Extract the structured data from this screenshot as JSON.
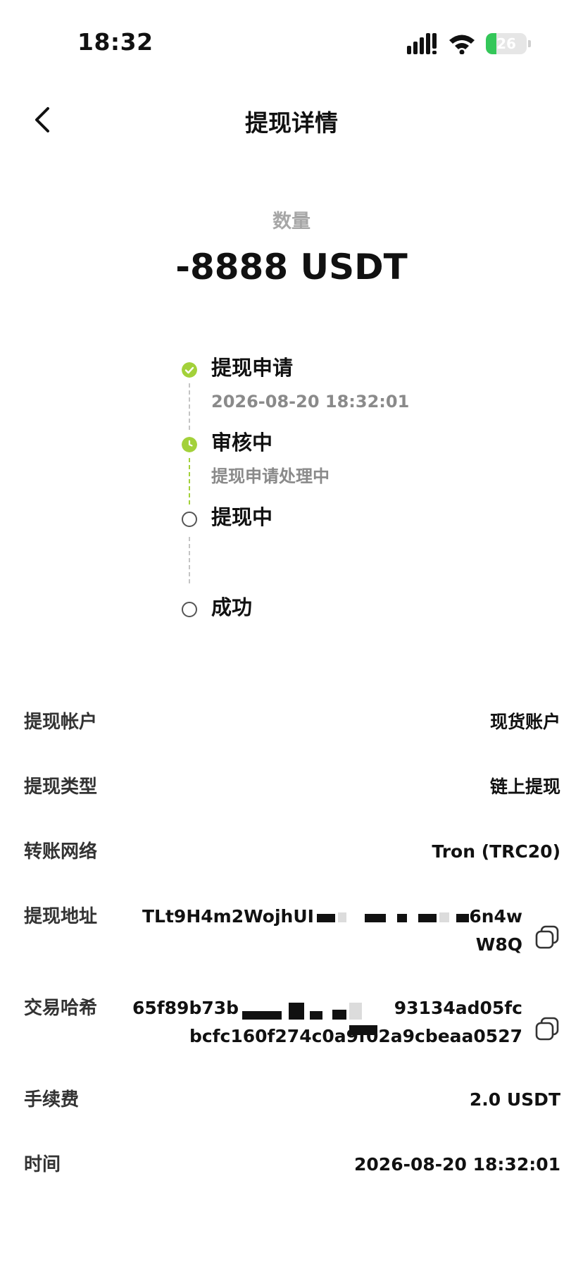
{
  "status_bar": {
    "time": "18:32",
    "battery_level": "26",
    "battery_fraction": 0.26,
    "icons": [
      "signal-icon",
      "wifi-icon",
      "battery-icon"
    ]
  },
  "nav": {
    "title": "提现详情",
    "back_icon": "chevron-left-icon"
  },
  "amount": {
    "label": "数量",
    "value": "-8888 USDT"
  },
  "timeline": {
    "steps": [
      {
        "title": "提现申请",
        "subtitle": "2026-08-20 18:32:01",
        "state": "done",
        "icon": "check-circle-icon"
      },
      {
        "title": "审核中",
        "subtitle": "提现申请处理中",
        "state": "active",
        "icon": "clock-circle-icon"
      },
      {
        "title": "提现中",
        "subtitle": "",
        "state": "pending",
        "icon": "empty-circle-icon"
      },
      {
        "title": "成功",
        "subtitle": "",
        "state": "pending",
        "icon": "empty-circle-icon"
      }
    ],
    "colors": {
      "done": "#a3d13a",
      "pending": "#555555"
    }
  },
  "details": {
    "account": {
      "label": "提现帐户",
      "value": "现货账户"
    },
    "type": {
      "label": "提现类型",
      "value": "链上提现"
    },
    "network": {
      "label": "转账网络",
      "value": "Tron (TRC20)"
    },
    "address": {
      "label": "提现地址",
      "line1": "TLt9H4m2WojhUI",
      "line1_end": "6n4w",
      "line2": "W8Q",
      "copy_icon": "copy-icon"
    },
    "tx_hash": {
      "label": "交易哈希",
      "line1": "65f89b73b",
      "line1_end": "93134ad05fc",
      "line2": "bcfc160f274c0a9f02a9cbeaa0527",
      "copy_icon": "copy-icon"
    },
    "fee": {
      "label": "手续费",
      "value": "2.0 USDT"
    },
    "time": {
      "label": "时间",
      "value": "2026-08-20 18:32:01"
    }
  }
}
